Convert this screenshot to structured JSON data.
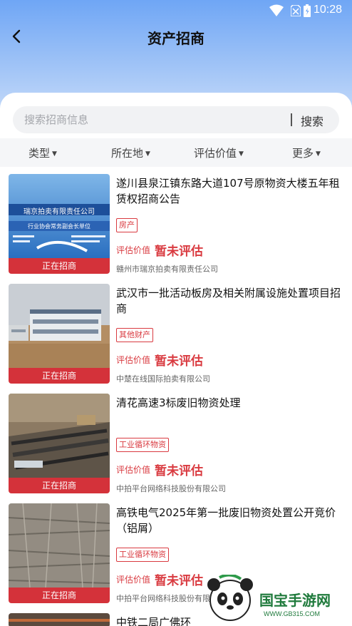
{
  "status_bar": {
    "time": "10:28"
  },
  "header": {
    "title": "资产招商"
  },
  "search": {
    "placeholder": "搜索招商信息",
    "button_label": "搜索"
  },
  "filters": [
    "类型",
    "所在地",
    "评估价值",
    "更多"
  ],
  "listings": [
    {
      "title": "遂川县泉江镇东路大道107号原物资大楼五年租赁权招商公告",
      "tag": "房产",
      "price_label": "评估价值",
      "price_value": "暂未评估",
      "org": "赣州市瑞京拍卖有限责任公司",
      "status": "正在招商",
      "image_text_1": "瑞京拍卖有限责任公司",
      "image_text_2": "行业协会常务副会长单位"
    },
    {
      "title": "武汉市一批活动板房及相关附属设施处置项目招商",
      "tag": "其他财产",
      "price_label": "评估价值",
      "price_value": "暂未评估",
      "org": "中楚在线国际拍卖有限公司",
      "status": "正在招商"
    },
    {
      "title": "清花高速3标废旧物资处理",
      "tag": "工业循环物资",
      "price_label": "评估价值",
      "price_value": "暂未评估",
      "org": "中拍平台网络科技股份有限公司",
      "status": "正在招商"
    },
    {
      "title": "高铁电气2025年第一批废旧物资处置公开竞价（铝屑）",
      "tag": "工业循环物资",
      "price_label": "评估价值",
      "price_value": "暂未评估",
      "org": "中拍平台网络科技股份有限公司",
      "status": "正在招商"
    },
    {
      "title": "中铁二局广佛环",
      "tag": "",
      "price_label": "",
      "price_value": "",
      "org": "",
      "status": ""
    }
  ],
  "watermark": {
    "text": "国宝手游网",
    "url": "WWW.GB315.COM"
  }
}
